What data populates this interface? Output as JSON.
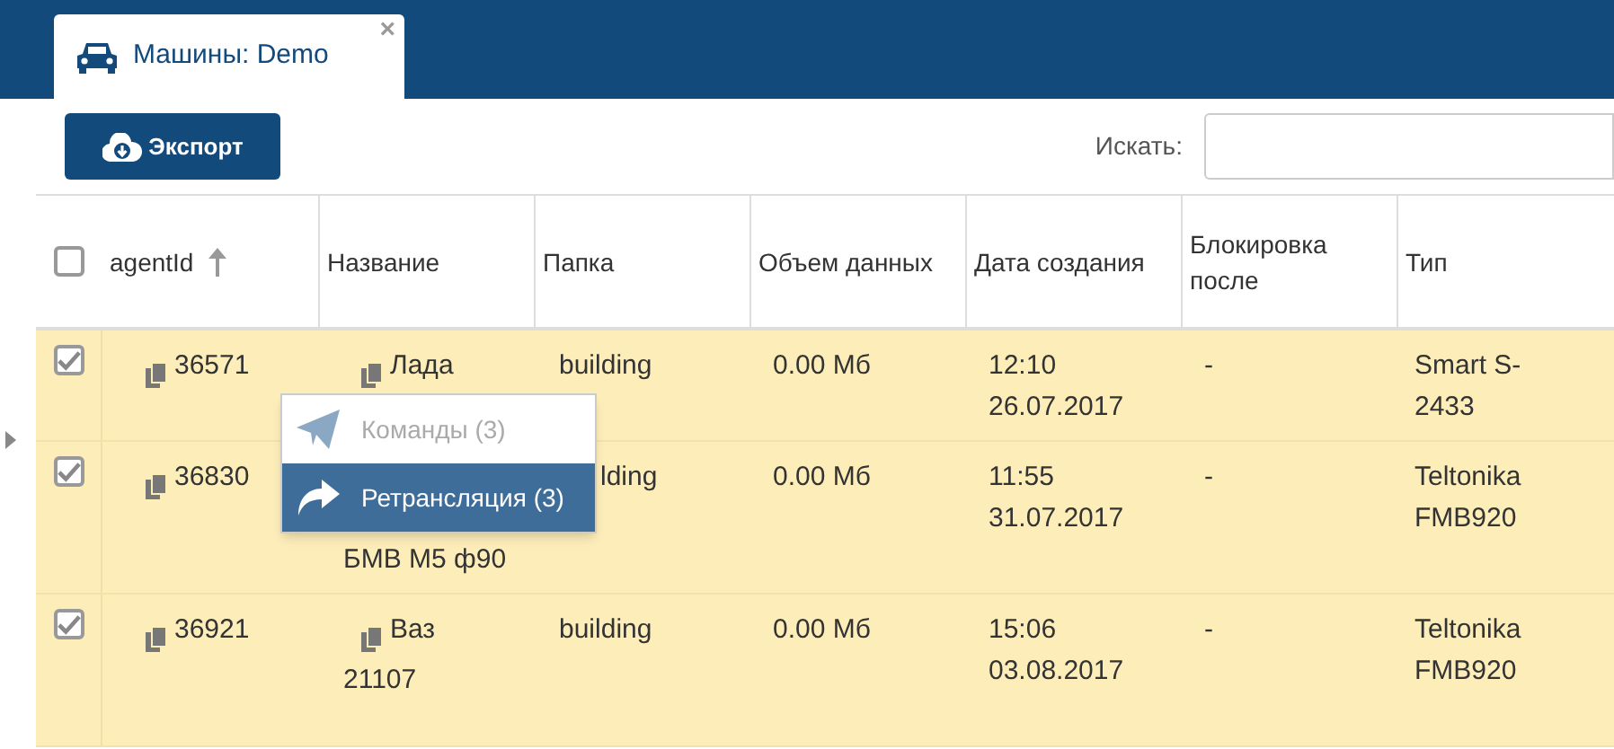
{
  "tab": {
    "title": "Машины: Demo",
    "close": "×"
  },
  "toolbar": {
    "export_button": "Экспорт",
    "search_label": "Искать:"
  },
  "table": {
    "select_all_checked": false,
    "columns": [
      {
        "label": "agentId",
        "sorted": true
      },
      {
        "label": "Название",
        "sorted": false
      },
      {
        "label": "Папка",
        "sorted": false
      },
      {
        "label": "Объем данных",
        "sorted": false
      },
      {
        "label": "Дата создания",
        "sorted": false
      },
      {
        "label": "Блокировка после",
        "sorted": false
      },
      {
        "label": "Тип",
        "sorted": false
      }
    ],
    "rows": [
      {
        "checked": true,
        "agent_id": "36571",
        "name_lines": [
          "Лада"
        ],
        "name_covered": false,
        "folder": "building",
        "folder_covered": false,
        "data_size": "0.00 Мб",
        "created": [
          "12:10",
          "26.07.2017"
        ],
        "block_after": "-",
        "type": [
          "Smart S-",
          "2433"
        ]
      },
      {
        "checked": true,
        "agent_id": "36830",
        "name_lines": [
          "БМВ M5 ф90"
        ],
        "name_covered": true,
        "folder": "lding",
        "folder_covered": true,
        "data_size": "0.00 Мб",
        "created": [
          "11:55",
          "31.07.2017"
        ],
        "block_after": "-",
        "type": [
          "Teltonika",
          "FMB920"
        ]
      },
      {
        "checked": true,
        "agent_id": "36921",
        "name_lines": [
          "Ваз",
          "21107"
        ],
        "name_covered": false,
        "folder": "building",
        "folder_covered": false,
        "data_size": "0.00 Мб",
        "created": [
          "15:06",
          "03.08.2017"
        ],
        "block_after": "-",
        "type": [
          "Teltonika",
          "FMB920"
        ]
      }
    ]
  },
  "context_menu": [
    {
      "kind": "send",
      "label": "Команды (3)",
      "disabled": true,
      "selected": false
    },
    {
      "kind": "forward",
      "label": "Ретрансляция (3)",
      "disabled": false,
      "selected": true
    }
  ]
}
